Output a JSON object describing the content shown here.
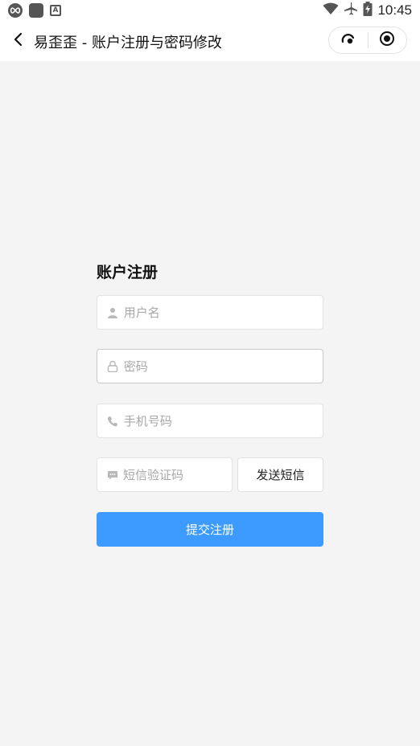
{
  "status_bar": {
    "time": "10:45",
    "left_icons": [
      "infinity-app-icon",
      "app-square-icon",
      "a-letter-icon"
    ],
    "right_icons": [
      "wifi-icon",
      "airplane-icon",
      "battery-charging-icon"
    ]
  },
  "nav": {
    "title": "易歪歪 - 账户注册与密码修改",
    "back_icon": "chevron-left-icon",
    "capsule_icons": [
      "more-dots-icon",
      "close-target-icon"
    ]
  },
  "form": {
    "title": "账户注册",
    "username_placeholder": "用户名",
    "password_placeholder": "密码",
    "phone_placeholder": "手机号码",
    "sms_code_placeholder": "短信验证码",
    "send_sms_label": "发送短信",
    "submit_label": "提交注册"
  },
  "colors": {
    "background": "#f4f4f4",
    "primary": "#3d9bff",
    "icon_gray": "#b8b8b8"
  }
}
